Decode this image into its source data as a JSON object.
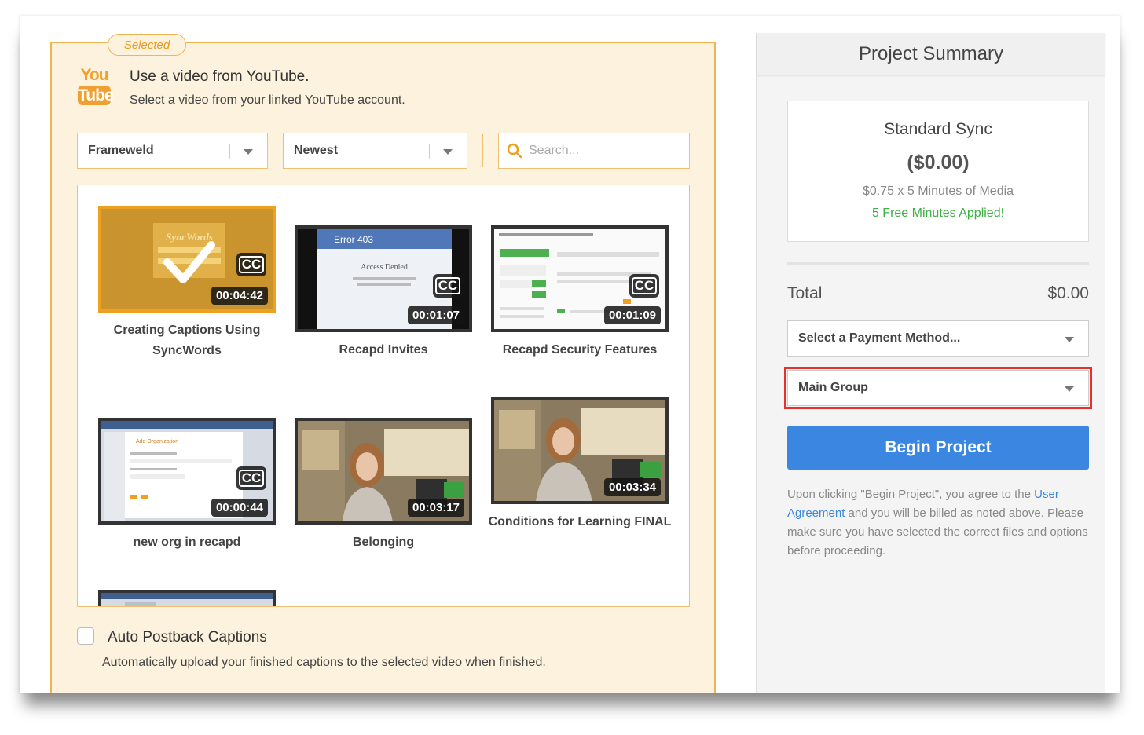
{
  "source": {
    "selected_badge": "Selected",
    "logo_you": "You",
    "logo_tube": "Tube",
    "title": "Use a video from YouTube.",
    "subtitle": "Select a video from your linked YouTube account.",
    "account_dropdown": "Frameweld",
    "sort_dropdown": "Newest",
    "search_placeholder": "Search..."
  },
  "videos": [
    {
      "title": "Creating Captions Using SyncWords",
      "duration": "00:04:42",
      "cc": "CC",
      "selected": true,
      "thumb_text": "SyncWords"
    },
    {
      "title": "Recapd Invites",
      "duration": "00:01:07",
      "cc": "CC",
      "thumb_text": "Error 403",
      "thumb_sub": "Access Denied"
    },
    {
      "title": "Recapd Security Features",
      "duration": "00:01:09",
      "cc": "CC"
    },
    {
      "title": "new org in recapd",
      "duration": "00:00:44",
      "cc": "CC",
      "thumb_text": "Add Organization"
    },
    {
      "title": "Belonging",
      "duration": "00:03:17"
    },
    {
      "title": "Conditions for Learning FINAL",
      "duration": "00:03:34"
    }
  ],
  "postback": {
    "label": "Auto Postback Captions",
    "description": "Automatically upload your finished captions to the selected video when finished."
  },
  "summary": {
    "header": "Project Summary",
    "plan_name": "Standard Sync",
    "plan_price": "($0.00)",
    "plan_rate": "$0.75 x 5 Minutes of Media",
    "plan_free": "5 Free Minutes Applied!",
    "total_label": "Total",
    "total_value": "$0.00",
    "payment_dropdown": "Select a Payment Method...",
    "group_dropdown": "Main Group",
    "begin_button": "Begin Project",
    "legal_pre": "Upon clicking \"Begin Project\", you agree to the ",
    "legal_link": "User Agreement",
    "legal_post": " and you will be billed as noted above. Please make sure you have selected the correct files and options before proceeding."
  },
  "colors": {
    "accent_orange": "#f0b450",
    "primary_blue": "#3b86e0",
    "success_green": "#3cb043",
    "highlight_red": "#e8302a"
  }
}
